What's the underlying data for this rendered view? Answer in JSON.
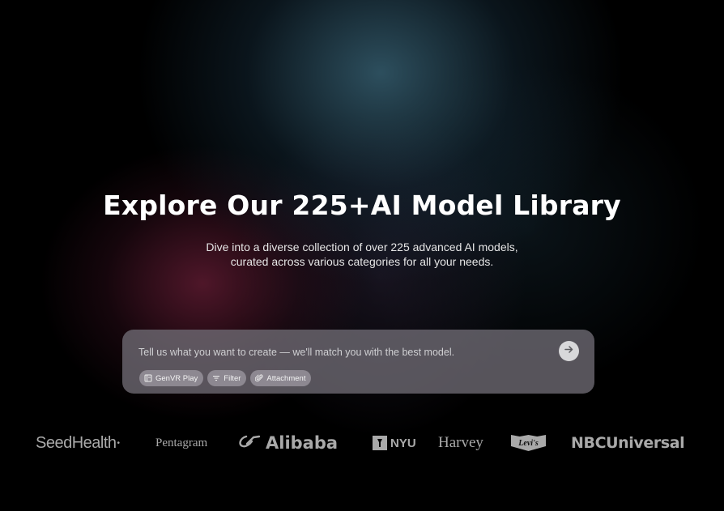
{
  "hero": {
    "title": "Explore Our 225+AI Model Library",
    "subtitle_line1": "Dive into a diverse collection of over 225 advanced AI models,",
    "subtitle_line2": "curated across various categories for all your needs."
  },
  "prompt": {
    "placeholder": "Tell us what you want to create — we'll match you with the best model.",
    "value": "",
    "send_icon": "arrow-right-icon",
    "chips": [
      {
        "label": "GenVR Play",
        "icon": "play-panel-icon"
      },
      {
        "label": "Filter",
        "icon": "filter-lines-icon"
      },
      {
        "label": "Attachment",
        "icon": "paperclip-icon"
      }
    ]
  },
  "logos": {
    "seedhealth": "SeedHealth",
    "seedhealth_mark": "•",
    "pentagram": "Pentagram",
    "alibaba": "Alibaba",
    "nyu": "NYU",
    "harvey": "Harvey",
    "levis": "Levi's",
    "nbcuniversal": "NBCUniversal"
  },
  "colors": {
    "background": "#000000",
    "title_text": "#ffffff",
    "prompt_box": "#706c74",
    "logo_gray": "#a9a9a9"
  }
}
